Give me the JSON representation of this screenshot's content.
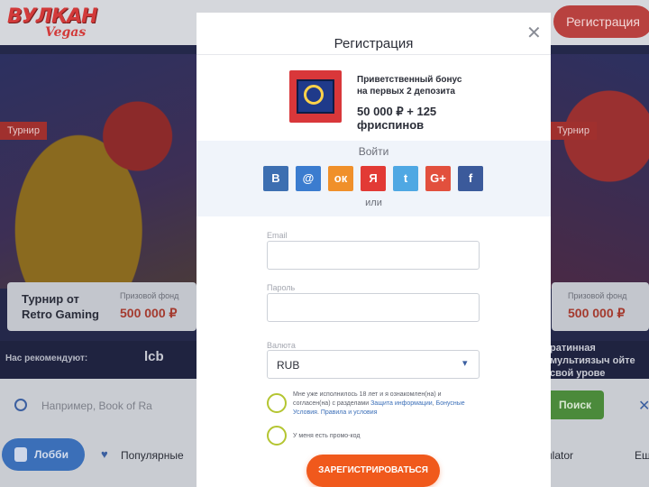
{
  "header": {
    "logo_main": "ВУЛКАН",
    "logo_sub": "Vegas",
    "register_button": "Регистрация"
  },
  "hero": {
    "tag_left": "Турнир",
    "tag_right": "Турнир",
    "tournament_title": "Турнир от Retro Gaming",
    "prize_label": "Призовой фонд",
    "prize_value": "500 000 ₽",
    "prize_label_right": "Призовой фонд",
    "prize_value_right": "500 000 ₽"
  },
  "recommend": {
    "label": "Нас рекомендуют:",
    "brand": "lcb",
    "right_text": "ратинная мультиязыч ойте свой урове"
  },
  "search": {
    "placeholder": "Например, Book of Ra",
    "button": "Поиск"
  },
  "nav": {
    "lobby": "Лобби",
    "popular": "Популярные",
    "emulator": "ulator",
    "more": "Еш"
  },
  "modal": {
    "title": "Регистрация",
    "bonus_text": "Приветственный бонус на первых 2 депозита",
    "bonus_amount": "50 000 ₽ + 125 фриспинов",
    "login_label": "Войти",
    "or_label": "или",
    "social": [
      {
        "glyph": "B",
        "icon": "vk-icon",
        "color": "#3d6fb1"
      },
      {
        "glyph": "@",
        "icon": "mailru-icon",
        "color": "#3b7ccf"
      },
      {
        "glyph": "ок",
        "icon": "odnoklassniki-icon",
        "color": "#f0902a"
      },
      {
        "glyph": "Я",
        "icon": "yandex-icon",
        "color": "#e23a35"
      },
      {
        "glyph": "t",
        "icon": "twitter-icon",
        "color": "#4fa8e3"
      },
      {
        "glyph": "G+",
        "icon": "google-plus-icon",
        "color": "#e2503d"
      },
      {
        "glyph": "f",
        "icon": "facebook-icon",
        "color": "#3b5a9b"
      }
    ],
    "email_label": "Email",
    "password_label": "Пароль",
    "currency_label": "Валюта",
    "currency_value": "RUB",
    "agree_text_1": "Мне уже исполнилось 18 лет и я ознакомлен(на) и согласен(на) с разделами ",
    "agree_link_1": "Защита информации",
    "agree_sep": ", ",
    "agree_link_2": "Бонусные Условия",
    "agree_link_3": "Правила и условия",
    "promo_text": "У меня есть промо-код",
    "submit": "ЗАРЕГИСТРИРОВАТЬСЯ"
  }
}
